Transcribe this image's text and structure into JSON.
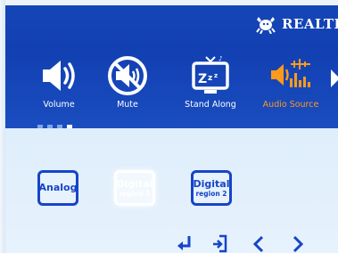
{
  "brand": {
    "text": "REALTEK"
  },
  "menu": {
    "items": [
      {
        "label": "Volume",
        "icon": "speaker-volume-icon"
      },
      {
        "label": "Mute",
        "icon": "speaker-mute-icon"
      },
      {
        "label": "Stand Along",
        "icon": "tv-sleep-icon"
      },
      {
        "label": "Audio Source",
        "icon": "audio-source-icon",
        "active": true
      }
    ]
  },
  "page_dots": {
    "count": 4,
    "current": 4
  },
  "options": [
    {
      "line1": "Analog",
      "line2": ""
    },
    {
      "line1": "Digital",
      "line2": "region 1",
      "selected": true
    },
    {
      "line1": "Digital",
      "line2": "region 2"
    }
  ],
  "colors": {
    "band": "#1546b8",
    "accent": "#ff9a1a",
    "option_blue": "#1744c8",
    "background": "#dbeaf8"
  }
}
